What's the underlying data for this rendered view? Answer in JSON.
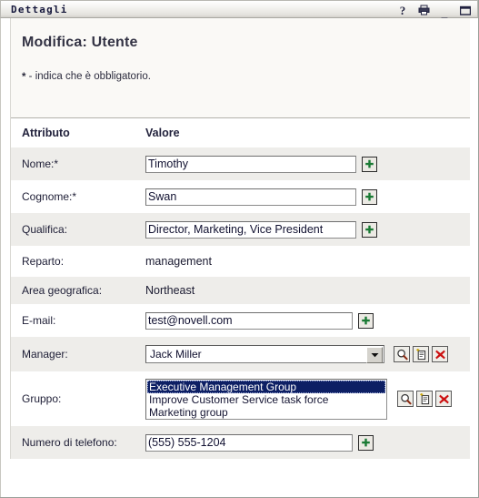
{
  "window": {
    "title": "Dettagli",
    "buttons": [
      {
        "name": "help-button",
        "glyph": "?"
      },
      {
        "name": "print-button",
        "glyph": "print"
      },
      {
        "name": "minimize-button",
        "glyph": "_"
      },
      {
        "name": "maximize-button",
        "glyph": "square"
      }
    ]
  },
  "header": {
    "page_title": "Modifica: Utente",
    "required_star": "*",
    "required_note": " - indica che è obbligatorio."
  },
  "table_header": {
    "attribute": "Attributo",
    "value": "Valore"
  },
  "rows": [
    {
      "label": "Nome:*",
      "type": "text",
      "value": "Timothy",
      "has_plus": true,
      "striped": true
    },
    {
      "label": "Cognome:*",
      "type": "text",
      "value": "Swan",
      "has_plus": true,
      "striped": false
    },
    {
      "label": "Qualifica:",
      "type": "text",
      "value": "Director, Marketing, Vice President",
      "has_plus": true,
      "striped": true
    },
    {
      "label": "Reparto:",
      "type": "static",
      "value": "management",
      "has_plus": false,
      "striped": false
    },
    {
      "label": "Area geografica:",
      "type": "static",
      "value": "Northeast",
      "has_plus": false,
      "striped": true
    },
    {
      "label": "E-mail:",
      "type": "text",
      "value": "test@novell.com",
      "has_plus": true,
      "striped": false
    },
    {
      "label": "Manager:",
      "type": "select",
      "value": "Jack Miller",
      "striped": true
    },
    {
      "label": "Gruppo:",
      "type": "listbox",
      "items": [
        "Executive Management Group",
        "Improve Customer Service task force",
        "Marketing group"
      ],
      "selected_index": 0,
      "striped": false
    },
    {
      "label": "Numero di telefono:",
      "type": "text",
      "value": "(555) 555-1204",
      "has_plus": true,
      "striped": true
    }
  ],
  "object_tools": {
    "search_label": "search-object",
    "new_label": "new-object",
    "delete_label": "delete-object"
  },
  "colors": {
    "titlebar_text": "#15173b",
    "stripe": "#eeedea",
    "header_panel": "#faf9f6",
    "plus_green": "#1a7a34",
    "delete_red": "#cc1111",
    "selection_blue": "#0d1f64"
  }
}
